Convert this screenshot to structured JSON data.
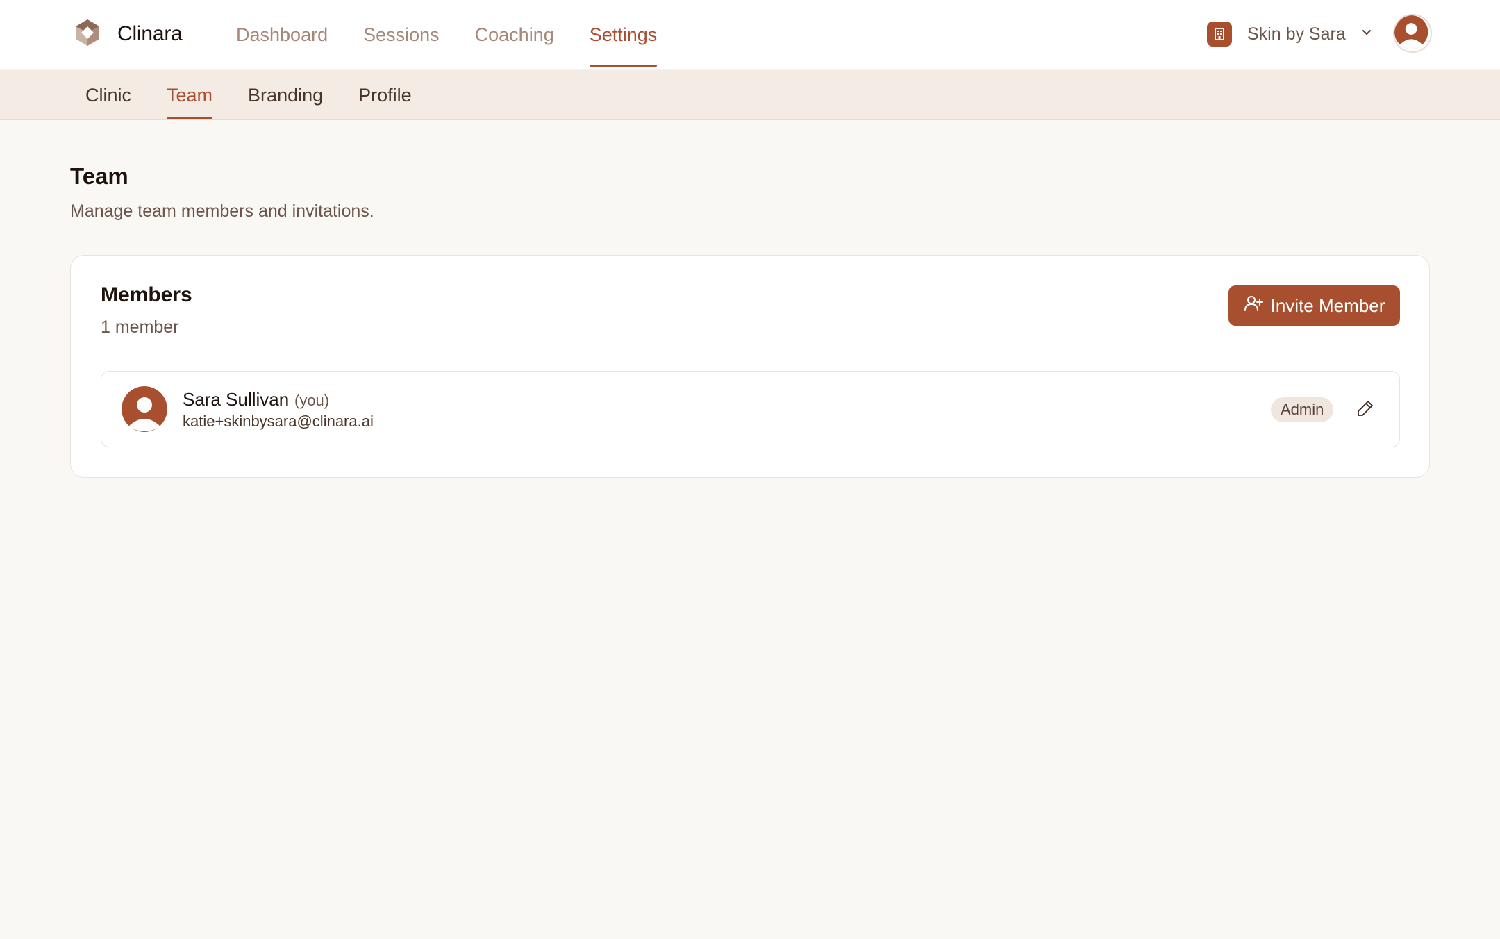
{
  "app": {
    "name": "Clinara",
    "logo_icon": "clinara-logo-icon",
    "accent_color": "#a84f30"
  },
  "main_nav": {
    "items": [
      {
        "label": "Dashboard",
        "active": false
      },
      {
        "label": "Sessions",
        "active": false
      },
      {
        "label": "Coaching",
        "active": false
      },
      {
        "label": "Settings",
        "active": true
      }
    ]
  },
  "clinic_switcher": {
    "icon": "building-icon",
    "name": "Skin by Sara",
    "chevron_icon": "chevron-down-icon"
  },
  "user_menu": {
    "icon": "user-avatar-icon"
  },
  "settings_tabs": {
    "items": [
      {
        "label": "Clinic",
        "active": false
      },
      {
        "label": "Team",
        "active": true
      },
      {
        "label": "Branding",
        "active": false
      },
      {
        "label": "Profile",
        "active": false
      }
    ]
  },
  "page": {
    "title": "Team",
    "subtitle": "Manage team members and invitations."
  },
  "members_card": {
    "title": "Members",
    "count_label": "1 member",
    "invite_button": {
      "label": "Invite Member",
      "icon": "user-plus-icon"
    },
    "members": [
      {
        "name": "Sara Sullivan",
        "self_tag": "(you)",
        "email": "katie+skinbysara@clinara.ai",
        "role": "Admin",
        "edit_icon": "pencil-icon"
      }
    ]
  }
}
